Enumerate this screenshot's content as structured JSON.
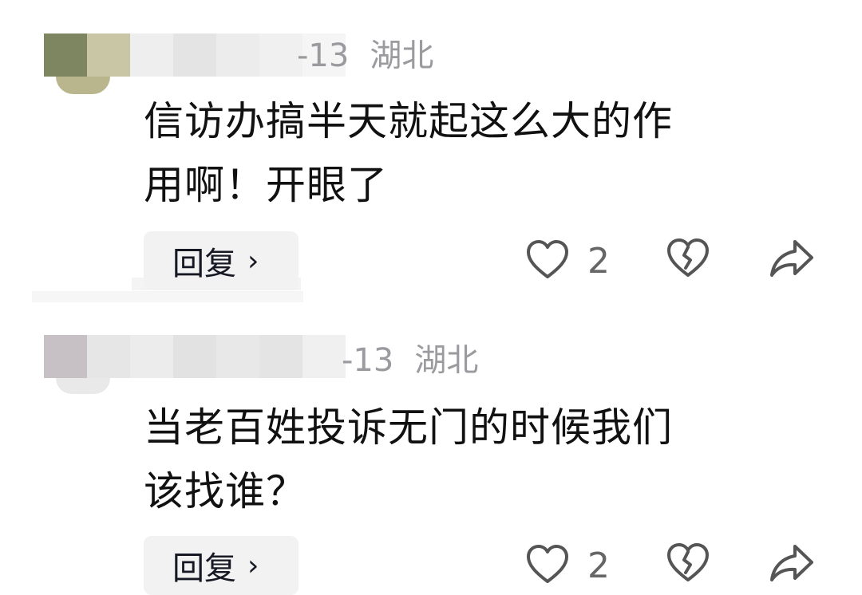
{
  "comments": [
    {
      "date_partial": "-13",
      "location": "湖北",
      "text_line1": "信访办搞半天就起这么大的作",
      "text_line2": "用啊！开眼了",
      "reply_label": "回复",
      "reply_chevron": "›",
      "like_count": "2"
    },
    {
      "date_partial": "-13",
      "location": "湖北",
      "text_line1": "当老百姓投诉无门的时候我们",
      "text_line2": "该找谁？",
      "reply_label": "回复",
      "reply_chevron": "›",
      "like_count": "2"
    }
  ],
  "icons": [
    "heart-icon",
    "broken-heart-icon",
    "share-icon"
  ],
  "colors": {
    "text": "#111111",
    "meta": "#9a9a9f",
    "icon": "#555555",
    "reply_bg": "#f2f2f2"
  }
}
